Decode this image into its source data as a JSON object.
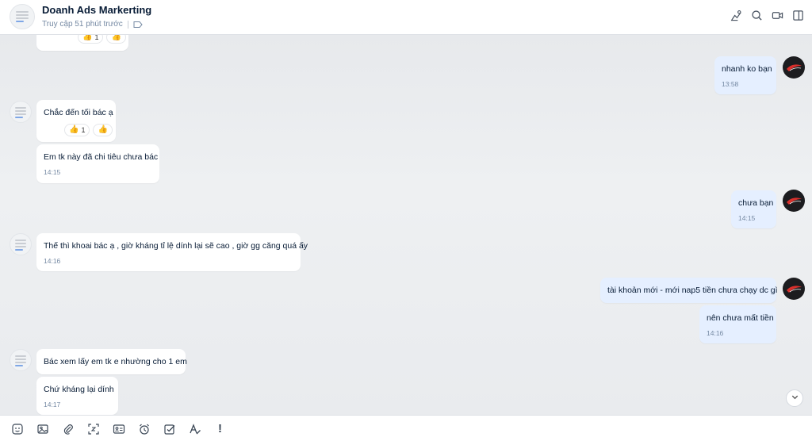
{
  "header": {
    "title": "Doanh Ads Markerting",
    "status": "Truy cập 51 phút trước",
    "icons": [
      "add-member-icon",
      "search-icon",
      "video-call-icon",
      "sidebar-toggle-icon"
    ]
  },
  "messages": {
    "top_partial": {
      "reaction_count": "1"
    },
    "m1": {
      "text": "nhanh ko bạn",
      "time": "13:58"
    },
    "m2": {
      "text": "Chắc đến tối bác ạ",
      "reaction_count": "1"
    },
    "m3": {
      "text": "Em tk này đã chi tiêu chưa bác",
      "time": "14:15"
    },
    "m4": {
      "text": "chưa bạn",
      "time": "14:15"
    },
    "m5": {
      "text": "Thế thì khoai bác ạ , giờ kháng tỉ lệ dính lại sẽ cao , giờ gg căng quá ấy",
      "time": "14:16"
    },
    "m6": {
      "text": "tài khoản mới - mới nap5 tiền chưa chạy dc gì"
    },
    "m7": {
      "text": "nên chưa mất tiền",
      "time": "14:16"
    },
    "m8": {
      "text": "Bác xem lấy em tk e nhường cho 1 em"
    },
    "m9": {
      "text": "Chứ kháng lại dính",
      "time": "14:17"
    }
  },
  "toolbar": {
    "icons": [
      "sticker-icon",
      "image-icon",
      "attachment-icon",
      "screenshot-icon",
      "contact-card-icon",
      "reminder-icon",
      "task-icon",
      "text-format-icon",
      "urgent-icon"
    ],
    "urgent_label": "!"
  },
  "colors": {
    "my_bubble": "#e5efff",
    "their_bubble": "#ffffff",
    "chat_bg": "#e9ebee",
    "accent": "#0068ff"
  }
}
